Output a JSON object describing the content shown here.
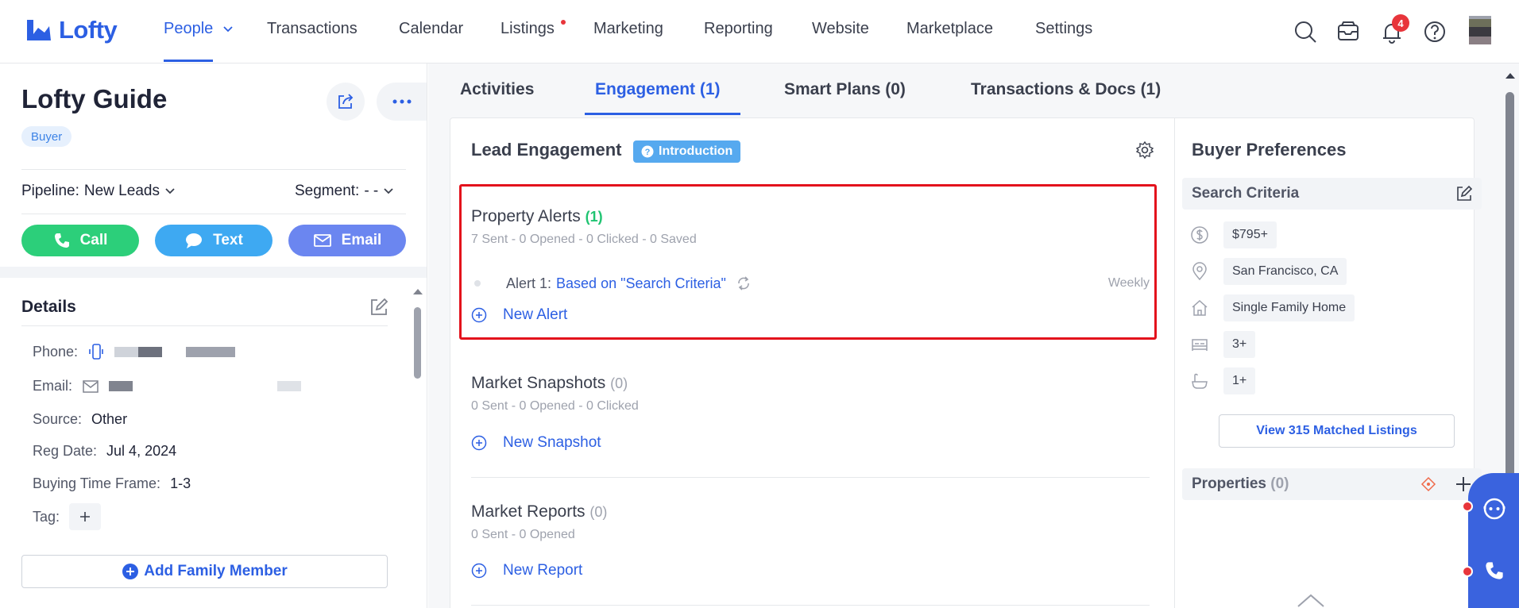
{
  "nav": {
    "logo_text": "Lofty",
    "items": [
      "People",
      "Transactions",
      "Calendar",
      "Listings",
      "Marketing",
      "Reporting",
      "Website",
      "Marketplace",
      "Settings"
    ],
    "notification_count": "4",
    "accent": "#2c5fe3"
  },
  "contact": {
    "name": "Lofty Guide",
    "role": "Buyer",
    "pipeline_label": "Pipeline:",
    "pipeline_value": "New Leads",
    "segment_label": "Segment:",
    "segment_value": "- -",
    "actions": {
      "call": "Call",
      "text": "Text",
      "email": "Email"
    },
    "details_title": "Details",
    "phone_label": "Phone:",
    "email_label": "Email:",
    "source_label": "Source:",
    "source_value": "Other",
    "reg_date_label": "Reg Date:",
    "reg_date_value": "Jul 4, 2024",
    "timeframe_label": "Buying Time Frame:",
    "timeframe_value": "1-3",
    "tag_label": "Tag:",
    "add_family": "Add Family Member"
  },
  "tabs": [
    "Activities",
    "Engagement (1)",
    "Smart Plans (0)",
    "Transactions & Docs (1)"
  ],
  "engagement": {
    "title": "Lead Engagement",
    "intro_badge": "Introduction",
    "property_alerts": {
      "title": "Property Alerts",
      "count": "(1)",
      "stats": "7 Sent - 0 Opened - 0 Clicked - 0 Saved",
      "alert_label": "Alert 1:",
      "alert_link": "Based on \"Search Criteria\"",
      "alert_freq": "Weekly",
      "new_label": "New Alert"
    },
    "market_snapshots": {
      "title": "Market Snapshots",
      "count": "(0)",
      "stats": "0 Sent - 0 Opened - 0 Clicked",
      "new_label": "New Snapshot"
    },
    "market_reports": {
      "title": "Market Reports",
      "count": "(0)",
      "stats": "0 Sent - 0 Opened",
      "new_label": "New Report"
    }
  },
  "buyer_prefs": {
    "title": "Buyer Preferences",
    "search_criteria_label": "Search Criteria",
    "criteria": {
      "price": "$795+",
      "location": "San Francisco, CA",
      "property_type": "Single Family Home",
      "beds": "3+",
      "baths": "1+"
    },
    "view_matched": "View 315 Matched Listings",
    "properties_label": "Properties",
    "properties_count": "(0)"
  }
}
